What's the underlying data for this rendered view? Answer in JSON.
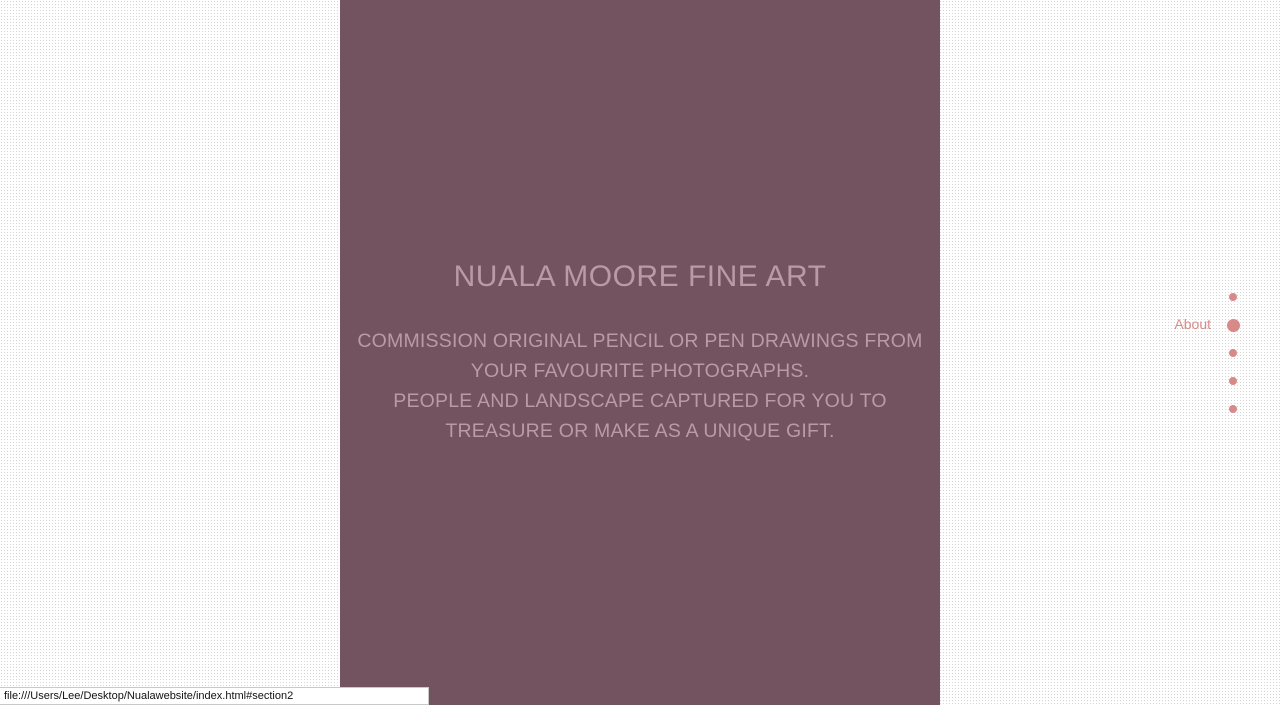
{
  "hero": {
    "title": "NUALA MOORE FINE ART",
    "lines": [
      "COMMISSION ORIGINAL PENCIL OR PEN DRAWINGS FROM",
      "YOUR FAVOURITE PHOTOGRAPHS.",
      "PEOPLE AND LANDSCAPE CAPTURED FOR YOU TO",
      "TREASURE OR MAKE AS A UNIQUE GIFT."
    ]
  },
  "dot_nav": {
    "active_label": "About",
    "accent_color": "#d88a88"
  },
  "status_bar": {
    "url": "file:///Users/Lee/Desktop/Nualawebsite/index.html#section2"
  },
  "colors": {
    "panel_background": "#73535f",
    "panel_text": "#b99aa6",
    "nav_accent": "#d88a88"
  }
}
